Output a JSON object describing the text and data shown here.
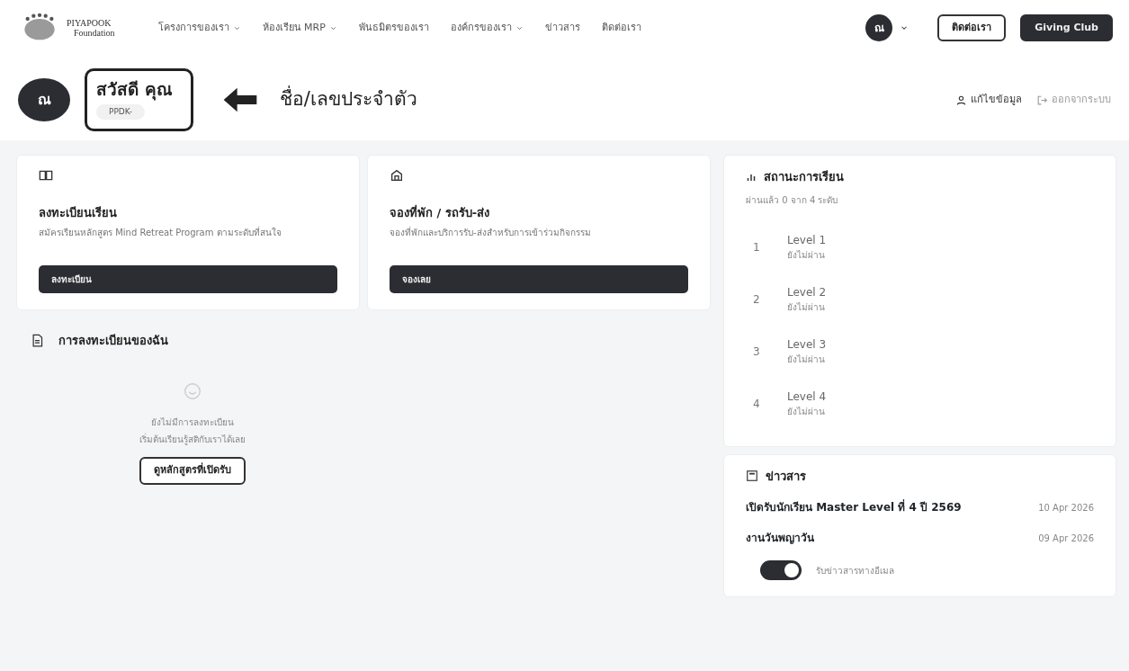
{
  "brand": {
    "name": "PIYAPOOK",
    "tagline": "Foundation"
  },
  "nav": [
    {
      "label": "โครงการของเรา",
      "dropdown": true
    },
    {
      "label": "ห้องเรียน MRP",
      "dropdown": true
    },
    {
      "label": "พันธมิตรของเรา",
      "dropdown": false
    },
    {
      "label": "องค์กรของเรา",
      "dropdown": true
    },
    {
      "label": "ข่าวสาร",
      "dropdown": false
    },
    {
      "label": "ติดต่อเรา",
      "dropdown": false
    }
  ],
  "user": {
    "initial": "ณ"
  },
  "nav_buttons": [
    {
      "label": "ติดต่อเรา",
      "kind": "outline"
    },
    {
      "label": "Giving Club",
      "kind": "solid"
    }
  ],
  "profile": {
    "initial": "ณ",
    "greeting": "สวัสดี คุณ",
    "member_id": "PPDK-",
    "annotation": "ชื่อ/เลขประจำตัว"
  },
  "profile_actions": [
    {
      "label": "แก้ไขข้อมูล",
      "kind": "edit"
    },
    {
      "label": "ออกจากระบบ",
      "kind": "logout"
    }
  ],
  "action_cards": [
    {
      "title": "ลงทะเบียนเรียน",
      "description": "สมัครเรียนหลักสูตร Mind Retreat Program ตามระดับที่สนใจ",
      "button": "ลงทะเบียน"
    },
    {
      "title": "จองที่พัก / รถรับ-ส่ง",
      "description": "จองที่พักและบริการรับ-ส่งสำหรับการเข้าร่วมกิจกรรม",
      "button": "จองเลย"
    }
  ],
  "registrations": {
    "title": "การลงทะเบียนของฉัน",
    "empty_lines": [
      "ยังไม่มีการลงทะเบียน",
      "เริ่มต้นเรียนรู้สติกับเราได้เลย"
    ],
    "button": "ดูหลักสูตรที่เปิดรับ"
  },
  "status": {
    "title": "สถานะการเรียน",
    "summary": "ผ่านแล้ว 0 จาก 4 ระดับ",
    "levels": [
      {
        "number": "1",
        "name": "Level 1",
        "state": "ยังไม่ผ่าน"
      },
      {
        "number": "2",
        "name": "Level 2",
        "state": "ยังไม่ผ่าน"
      },
      {
        "number": "3",
        "name": "Level 3",
        "state": "ยังไม่ผ่าน"
      },
      {
        "number": "4",
        "name": "Level 4",
        "state": "ยังไม่ผ่าน"
      }
    ]
  },
  "news": {
    "title": "ข่าวสาร",
    "items": [
      {
        "title": "เปิดรับนักเรียน Master Level ที่ 4 ปี 2569",
        "date": "10 Apr 2026"
      },
      {
        "title": "งานวันพญาวัน",
        "date": "09 Apr 2026"
      }
    ],
    "subscribe": {
      "label": "รับข่าวสารทางอีเมล",
      "on": true
    }
  }
}
